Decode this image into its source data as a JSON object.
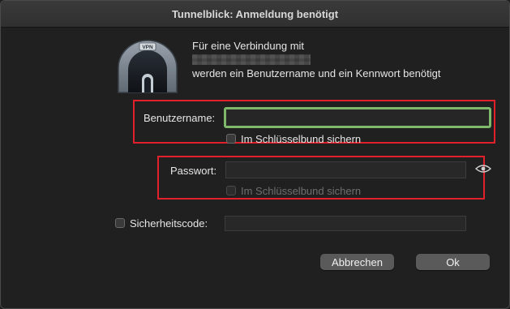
{
  "window": {
    "title": "Tunnelblick: Anmeldung benötigt"
  },
  "icon": {
    "name": "vpn-tunnel-icon",
    "badge": "VPN"
  },
  "message": {
    "line1": "Für eine Verbindung mit",
    "line3": "werden ein Benutzername und ein Kennwort benötigt"
  },
  "username": {
    "label": "Benutzername:",
    "value": "",
    "save_label": "Im Schlüsselbund sichern"
  },
  "password": {
    "label": "Passwort:",
    "value": "",
    "save_label": "Im Schlüsselbund sichern"
  },
  "security_code": {
    "label": "Sicherheitscode:",
    "value": ""
  },
  "buttons": {
    "cancel": "Abbrechen",
    "ok": "Ok"
  },
  "colors": {
    "focus_ring": "#7fb86a",
    "annotation": "#e0202a"
  }
}
